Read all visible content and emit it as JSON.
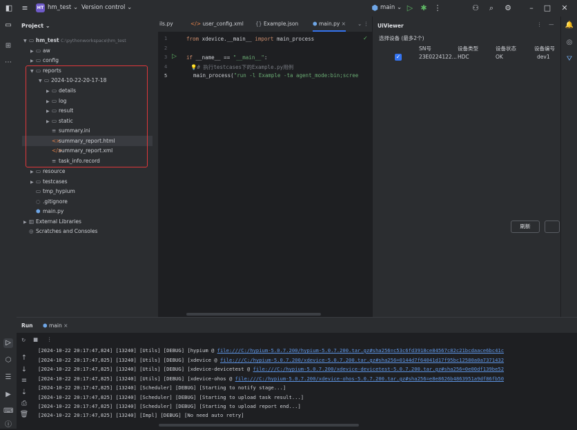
{
  "titlebar": {
    "app_badge": "HT",
    "project_name": "hm_test",
    "vcs": "Version control",
    "branch": "main"
  },
  "project_panel": {
    "title": "Project",
    "root_name": "hm_test",
    "root_path": "C:\\pythonworkspace\\hm_test",
    "items": [
      {
        "label": "aw"
      },
      {
        "label": "config"
      },
      {
        "label": "reports"
      },
      {
        "label": "2024-10-22-20-17-18"
      },
      {
        "label": "details"
      },
      {
        "label": "log"
      },
      {
        "label": "result"
      },
      {
        "label": "static"
      },
      {
        "label": "summary.ini"
      },
      {
        "label": "summary_report.html"
      },
      {
        "label": "summary_report.xml"
      },
      {
        "label": "task_info.record"
      },
      {
        "label": "resource"
      },
      {
        "label": "testcases"
      },
      {
        "label": "tmp_hypium"
      },
      {
        "label": ".gitignore"
      },
      {
        "label": "main.py"
      },
      {
        "label": "External Libraries"
      },
      {
        "label": "Scratches and Consoles"
      }
    ]
  },
  "editor": {
    "tabs": [
      {
        "label": "ils.py"
      },
      {
        "label": "user_config.xml"
      },
      {
        "label": "Example.json"
      },
      {
        "label": "main.py"
      }
    ],
    "line_numbers": [
      "1",
      "2",
      "3",
      "4",
      "5"
    ],
    "lines": {
      "l1_kw1": "from",
      "l1_mid": " xdevice.__main__ ",
      "l1_kw2": "import",
      "l1_end": " main_process",
      "l3_kw": "if",
      "l3_mid": " __name__ == ",
      "l3_str": "\"__main__\"",
      "l3_end": ":",
      "l4_cmt": "# 执行testcases下的Example.py用例",
      "l5_fn": "main_process(",
      "l5_str": "\"run -l Example -ta agent_mode:bin;scree"
    }
  },
  "uiviewer": {
    "title": "UiViewer",
    "select_label": "选择设备 (最多2个)",
    "columns": [
      "SN号",
      "设备类型",
      "设备状态",
      "设备编号"
    ],
    "row": {
      "sn": "23E0224122...",
      "type": "HDC",
      "status": "OK",
      "num": "dev1"
    },
    "refresh_label": "刷新"
  },
  "run": {
    "tab_label": "Run",
    "config_label": "main",
    "logs": [
      {
        "pre": "[2024-10-22 20:17:47,824] [13240] [Utils] [DEBUG] [hypium @ ",
        "link": "file:///C:/hypium-5.0.7.200/hypium-5.0.7.200.tar.gz#sha256=c53c6fd3918ce84567c82c21bcdaace6bc41c"
      },
      {
        "pre": "[2024-10-22 20:17:47,825] [13240] [Utils] [DEBUG] [xdevice @ ",
        "link": "file:///C:/hypium-5.0.7.200/xdevice-5.0.7.200.tar.gz#sha256=0144d7f64041d17f95bc12580a0a7371432"
      },
      {
        "pre": "[2024-10-22 20:17:47,825] [13240] [Utils] [DEBUG] [xdevice-devicetest @ ",
        "link": "file:///C:/hypium-5.0.7.200/xdevice-devicetest-5.0.7.200.tar.gz#sha256=0e00df139be52"
      },
      {
        "pre": "[2024-10-22 20:17:47,825] [13240] [Utils] [DEBUG] [xdevice-ohos @ ",
        "link": "file:///C:/hypium-5.0.7.200/xdevice-ohos-5.0.7.200.tar.gz#sha256=e8e8626b4863951a9df86fb50"
      },
      {
        "pre": "[2024-10-22 20:17:47,825] [13240] [Scheduler] [DEBUG] [Starting to notify stage...]",
        "link": ""
      },
      {
        "pre": "[2024-10-22 20:17:47,825] [13240] [Scheduler] [DEBUG] [Starting to upload task result...]",
        "link": ""
      },
      {
        "pre": "[2024-10-22 20:17:47,825] [13240] [Scheduler] [DEBUG] [Starting to upload report end...]",
        "link": ""
      },
      {
        "pre": "[2024-10-22 20:17:47,825] [13240] [Impl] [DEBUG] [No need auto retry]",
        "link": ""
      }
    ]
  }
}
